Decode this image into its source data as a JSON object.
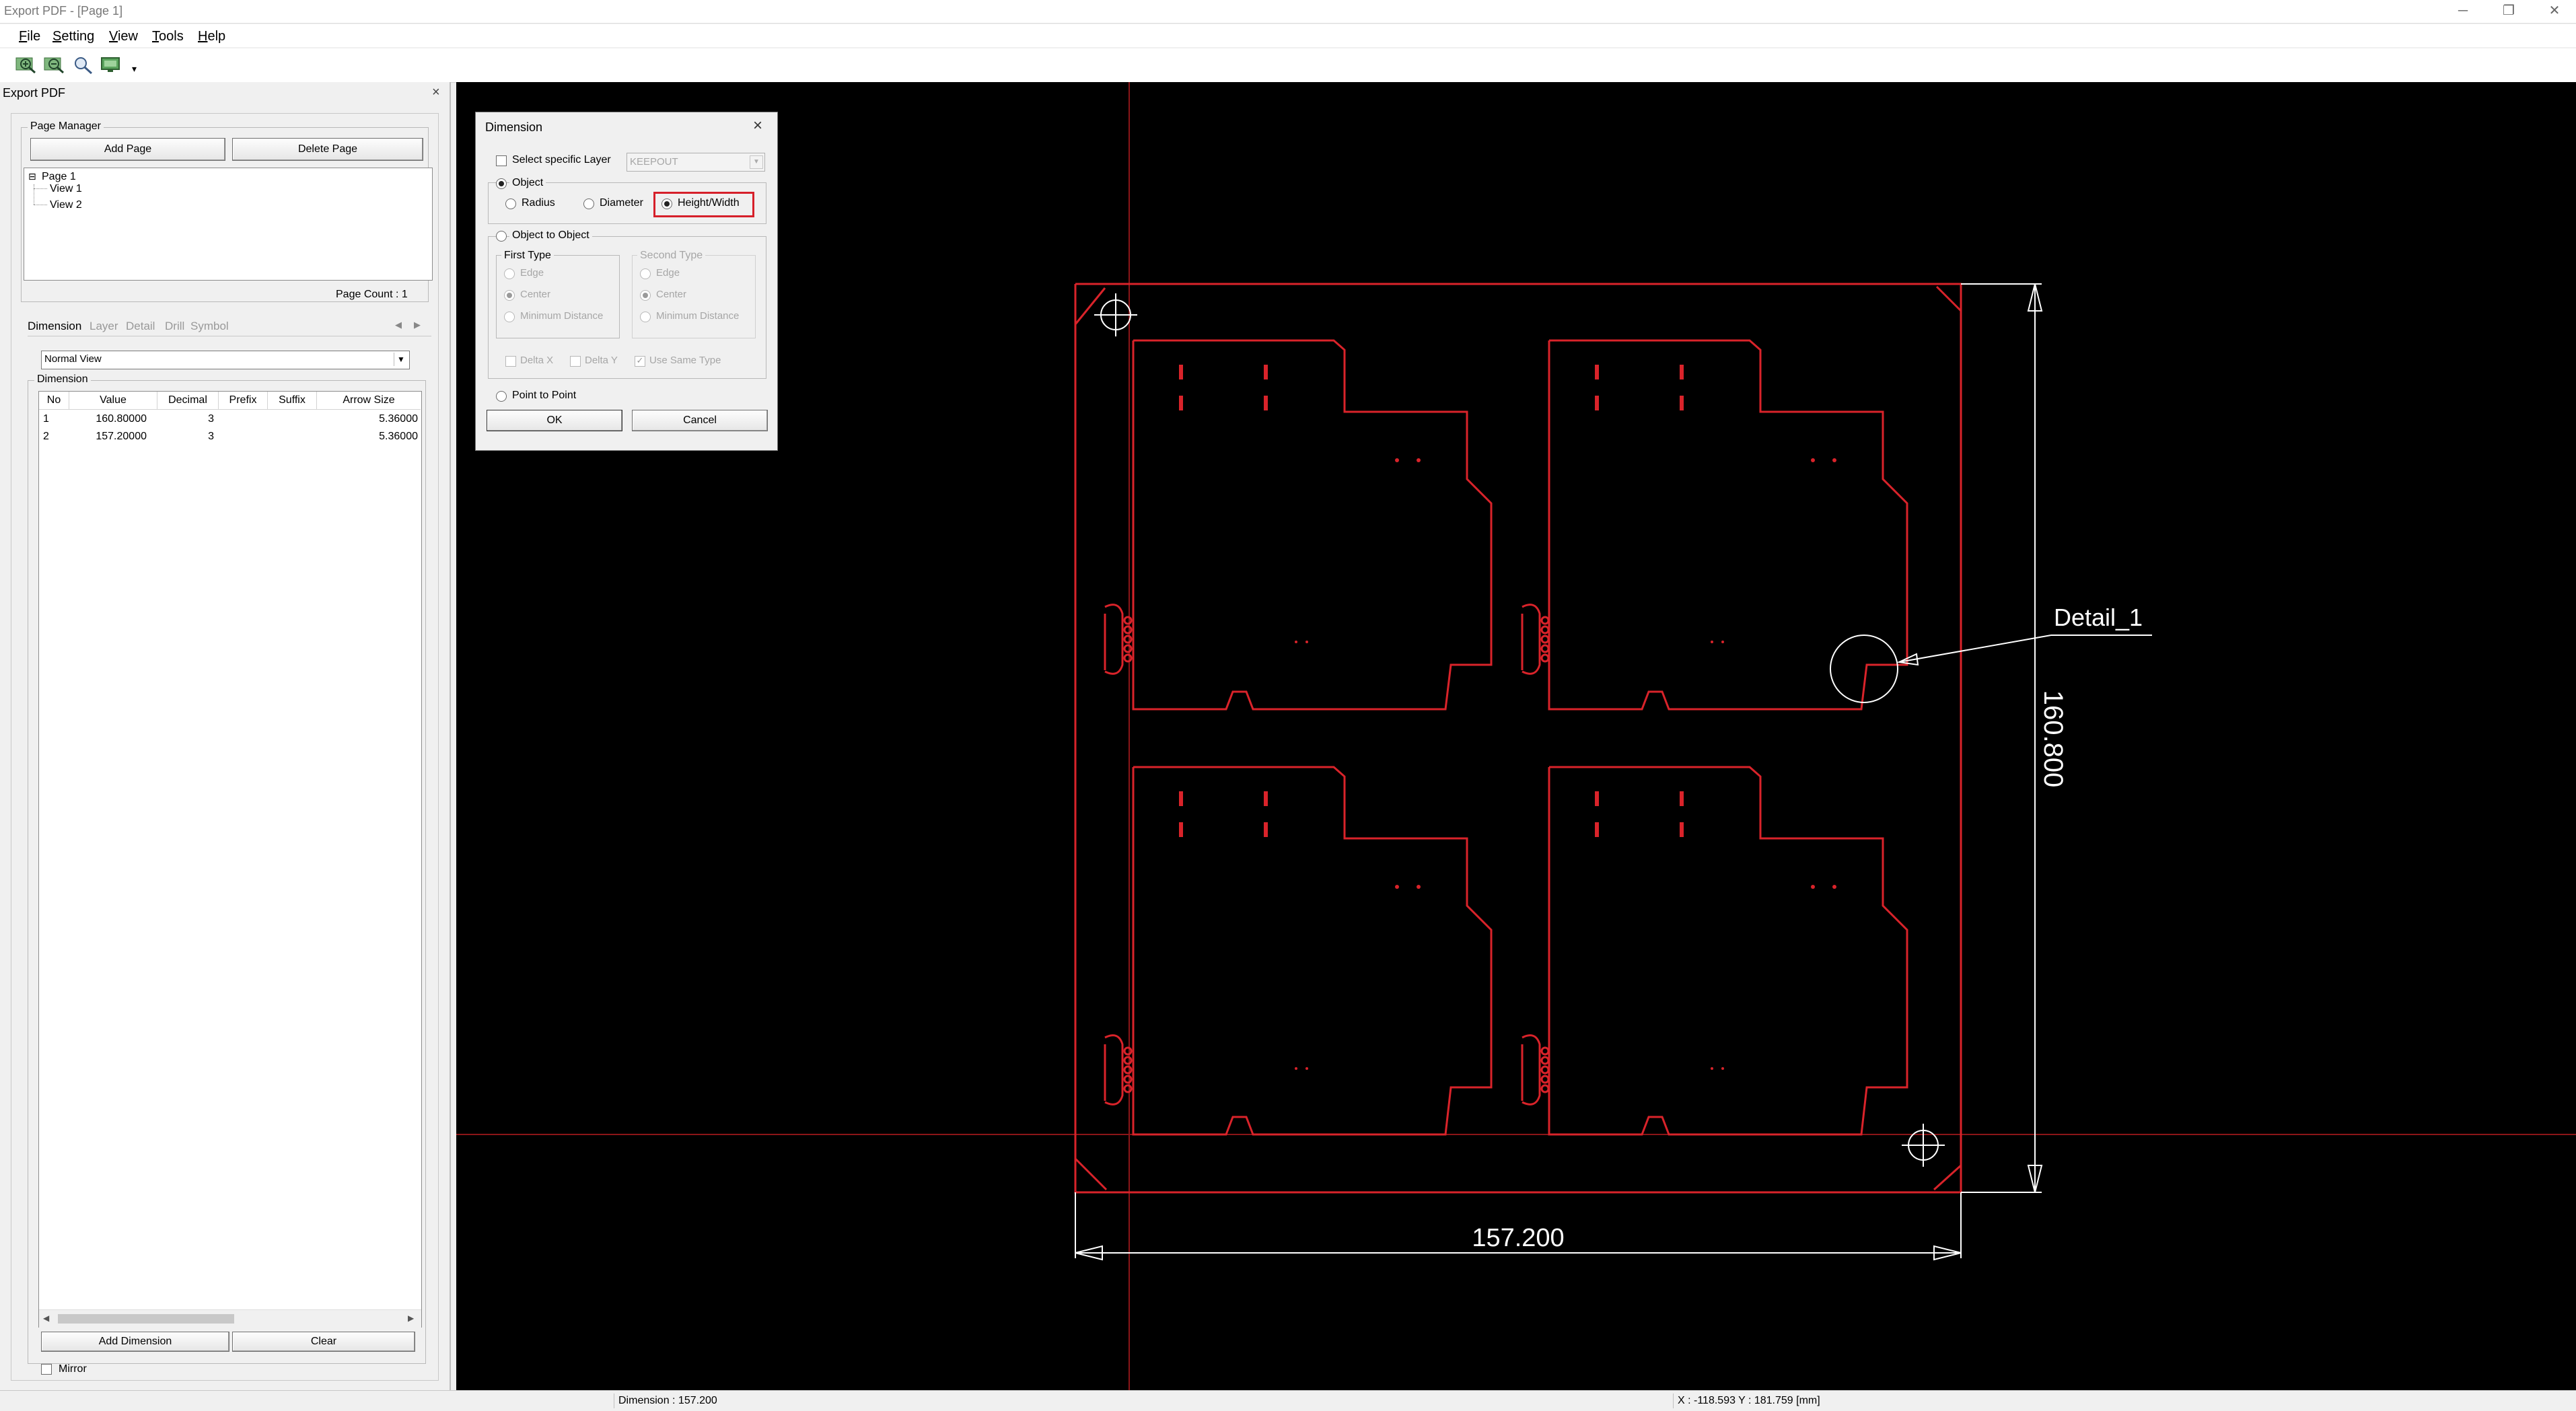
{
  "window": {
    "title": "Export PDF - [Page 1]",
    "controls": {
      "minimize": "─",
      "restore": "❐",
      "close": "✕"
    }
  },
  "menu": [
    {
      "label": "File",
      "mnemonic": "F",
      "rest": "ile"
    },
    {
      "label": "Setting",
      "mnemonic": "S",
      "rest": "etting"
    },
    {
      "label": "View",
      "mnemonic": "V",
      "rest": "iew"
    },
    {
      "label": "Tools",
      "mnemonic": "T",
      "rest": "ools"
    },
    {
      "label": "Help",
      "mnemonic": "H",
      "rest": "elp"
    }
  ],
  "toolbar": {
    "icons": [
      "zoom-in-icon",
      "zoom-out-icon",
      "zoom-fit-icon",
      "monitor-icon"
    ],
    "overflow": "▾"
  },
  "left_panel": {
    "title": "Export PDF",
    "close": "×",
    "page_manager": {
      "title": "Page Manager",
      "add_page": "Add Page",
      "delete_page": "Delete Page",
      "tree": {
        "toggle": "⊟",
        "page": "Page 1",
        "views": [
          "View 1",
          "View 2"
        ]
      },
      "page_count": "Page Count : 1"
    },
    "tabs": [
      "Dimension",
      "Layer",
      "Detail",
      "Drill",
      "Symbol"
    ],
    "active_tab": "Dimension",
    "tab_nav": {
      "prev": "◀",
      "next": "▶"
    },
    "view_mode": "Normal View",
    "dimension_group": {
      "title": "Dimension",
      "columns": [
        "No",
        "Value",
        "Decimal",
        "Prefix",
        "Suffix",
        "Arrow Size"
      ],
      "rows": [
        [
          "1",
          "160.80000",
          "3",
          "",
          "",
          "5.36000"
        ],
        [
          "2",
          "157.20000",
          "3",
          "",
          "",
          "5.36000"
        ]
      ],
      "scroll_left": "◀",
      "scroll_right": "▶",
      "add_dimension": "Add Dimension",
      "clear": "Clear"
    },
    "mirror_label": "Mirror",
    "mirror_checked": false
  },
  "dialog": {
    "title": "Dimension",
    "close": "×",
    "select_specific_layer": "Select specific Layer",
    "select_specific_layer_checked": false,
    "layer_value": "KEEPOUT",
    "object_label": "Object",
    "object_selected": true,
    "object_options": [
      "Radius",
      "Diameter",
      "Height/Width"
    ],
    "object_option_selected": "Height/Width",
    "object_to_object": "Object to Object",
    "first_type": {
      "title": "First Type",
      "options": [
        "Edge",
        "Center",
        "Minimum Distance"
      ],
      "selected": "Center"
    },
    "second_type": {
      "title": "Second Type",
      "options": [
        "Edge",
        "Center",
        "Minimum Distance"
      ],
      "selected": "Center"
    },
    "delta_x": "Delta X",
    "delta_y": "Delta Y",
    "use_same_type": "Use Same Type",
    "use_same_type_checked": true,
    "point_to_point": "Point to Point",
    "ok": "OK",
    "cancel": "Cancel"
  },
  "drawing": {
    "height_dimension": "160.800",
    "width_dimension": "157.200",
    "detail_label": "Detail_1",
    "colors": {
      "board": "#d9232a",
      "annotation": "#ffffff",
      "crosshair": "#8b1518",
      "background": "#000000"
    }
  },
  "status": {
    "dimension": "Dimension : 157.200",
    "coordinates": "X : -118.593  Y : 181.759 [mm]"
  }
}
